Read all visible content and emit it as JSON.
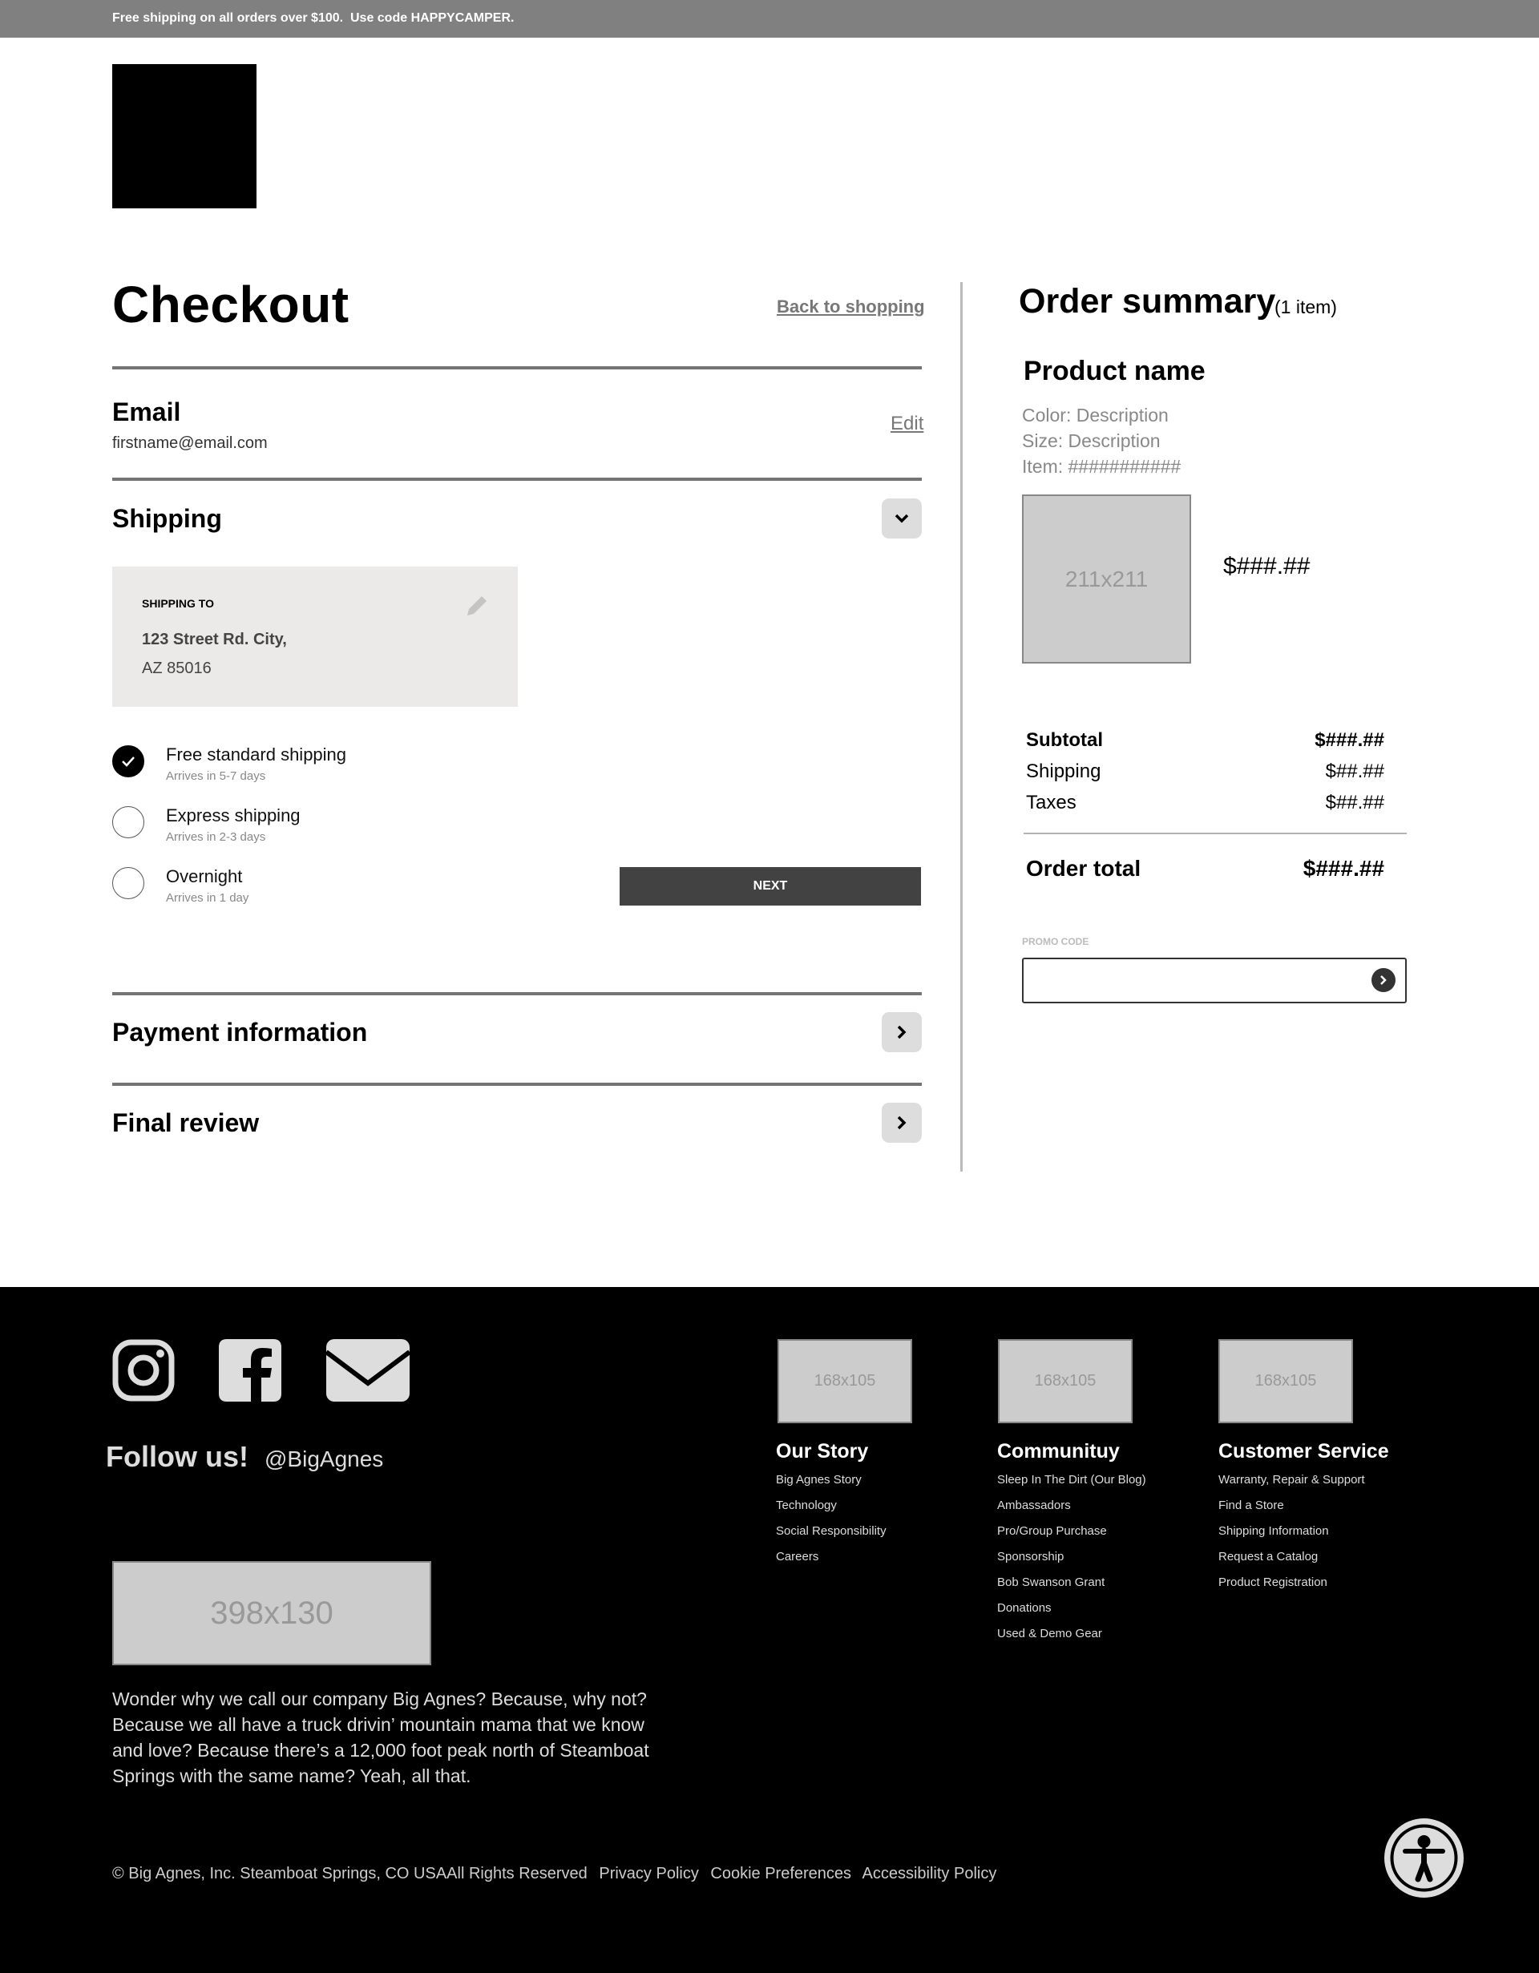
{
  "promo_banner": {
    "text": "Free shipping on all orders over $100.  Use code HAPPYCAMPER."
  },
  "header": {
    "logo_alt": "Big Agnes logo"
  },
  "checkout": {
    "title": "Checkout",
    "back_link": "Back to shopping",
    "email": {
      "title": "Email",
      "value": "firstname@email.com",
      "edit_label": "Edit"
    },
    "shipping": {
      "title": "Shipping",
      "expanded": true,
      "address_card": {
        "label": "SHIPPING TO",
        "line1": "123 Street Rd. City,",
        "line2": "AZ 85016"
      },
      "options": [
        {
          "label": "Free standard shipping",
          "sub": "Arrives in 5-7 days",
          "selected": true
        },
        {
          "label": "Express shipping",
          "sub": "Arrives in 2-3 days",
          "selected": false
        },
        {
          "label": "Overnight",
          "sub": "Arrives in 1 day",
          "selected": false
        }
      ],
      "next_label": "NEXT"
    },
    "payment": {
      "title": "Payment information"
    },
    "review": {
      "title": "Final review"
    }
  },
  "summary": {
    "title": "Order summary",
    "count": "(1 item)",
    "product": {
      "name": "Product name",
      "color": "Color: Description",
      "size": "Size: Description",
      "item": "Item: ###########",
      "image_placeholder": "211x211",
      "price": "$###.##"
    },
    "totals": [
      {
        "label": "Subtotal",
        "value": "$###.##",
        "bold": true
      },
      {
        "label": "Shipping",
        "value": "$##.##",
        "bold": false
      },
      {
        "label": "Taxes",
        "value": "$##.##",
        "bold": false
      }
    ],
    "order_total": {
      "label": "Order total",
      "value": "$###.##"
    },
    "promo": {
      "label": "PROMO CODE",
      "value": "",
      "placeholder": ""
    }
  },
  "footer": {
    "social_icons": [
      "instagram-icon",
      "facebook-icon",
      "email-icon"
    ],
    "follow_label": "Follow us!",
    "handle": "@BigAgnes",
    "banner_placeholder": "398x130",
    "about": "Wonder why we call our company Big Agnes? Because, why not? Because we all have a truck drivin’ mountain mama that we know and love? Because there’s a 12,000 foot peak north of Steamboat Springs with the same name? Yeah, all that.",
    "columns": [
      {
        "image_placeholder": "168x105",
        "title": "Our Story",
        "links": [
          "Big Agnes Story",
          "Technology",
          "Social Responsibility",
          "Careers"
        ]
      },
      {
        "image_placeholder": "168x105",
        "title": "Communituy",
        "links": [
          "Sleep In The Dirt (Our Blog)",
          "Ambassadors",
          "Pro/Group Purchase",
          "Sponsorship",
          "Bob Swanson Grant",
          "Donations",
          "Used & Demo Gear"
        ]
      },
      {
        "image_placeholder": "168x105",
        "title": "Customer Service",
        "links": [
          "Warranty, Repair & Support",
          "Find a Store",
          "Shipping Information",
          "Request a Catalog",
          "Product Registration"
        ]
      }
    ],
    "legal": {
      "copyright": "© Big Agnes, Inc. Steamboat Springs, CO USAAll Rights Reserved",
      "links": [
        "Privacy Policy",
        "Cookie Preferences",
        "Accessibility Policy"
      ]
    },
    "accessibility_button": "accessibility-icon"
  }
}
